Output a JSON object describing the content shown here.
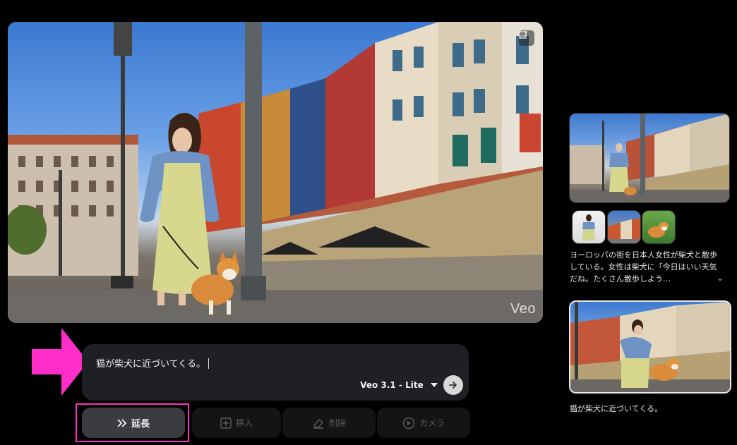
{
  "main_video": {
    "watermark": "Veo"
  },
  "prompt": {
    "text": "猫が柴犬に近づいてくる。",
    "model_label": "Veo 3.1 - Lite"
  },
  "actions": {
    "extend": "延長",
    "insert": "挿入",
    "delete": "削除",
    "camera": "カメラ"
  },
  "sidebar": {
    "clip1_description": "ヨーロッパの街を日本人女性が柴犬と散歩している。女性は柴犬に「今日はいい天気だね。たくさん散歩しよう…",
    "clip2_caption": "猫が柴犬に近づいてくる。"
  },
  "colors": {
    "highlight": "#ff2ec8",
    "background": "#000000",
    "prompt_bg": "#1f2023"
  }
}
